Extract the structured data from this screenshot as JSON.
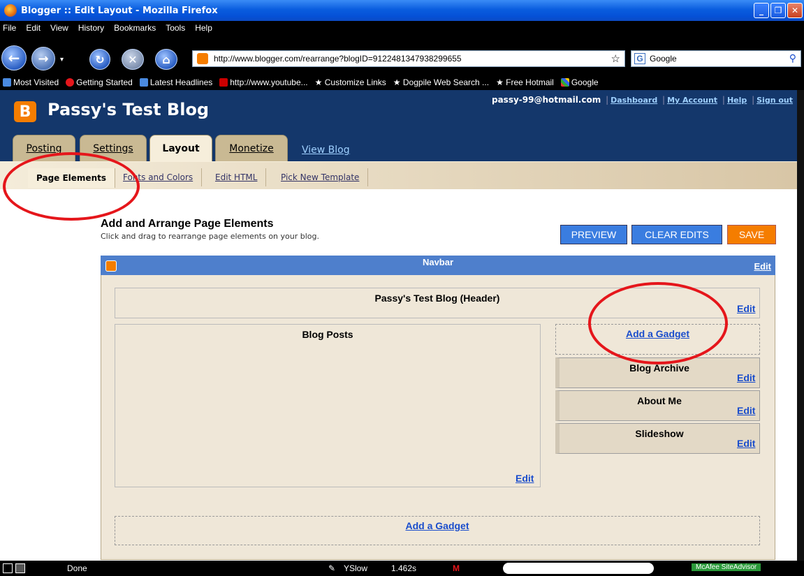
{
  "window": {
    "title": "Blogger :: Edit Layout - Mozilla Firefox"
  },
  "menu": [
    "File",
    "Edit",
    "View",
    "History",
    "Bookmarks",
    "Tools",
    "Help"
  ],
  "browser": {
    "url": "http://www.blogger.com/rearrange?blogID=9122481347938299655",
    "search": "Google"
  },
  "bookmarks": [
    "Most Visited",
    "Getting Started",
    "Latest Headlines",
    "http://www.youtube...",
    "Customize Links",
    "Dogpile Web Search ...",
    "Free Hotmail",
    "Google"
  ],
  "blog": {
    "title": "Passy's Test Blog",
    "email": "passy-99@hotmail.com",
    "links": [
      "Dashboard",
      "My Account",
      "Help",
      "Sign out"
    ]
  },
  "tabs": [
    "Posting",
    "Settings",
    "Layout",
    "Monetize"
  ],
  "view_blog": "View Blog",
  "subnav": [
    "Page Elements",
    "Fonts and Colors",
    "Edit HTML",
    "Pick New Template"
  ],
  "content": {
    "heading": "Add and Arrange Page Elements",
    "subheading": "Click and drag to rearrange page elements on your blog.",
    "preview": "PREVIEW",
    "clear": "CLEAR EDITS",
    "save": "SAVE",
    "navbar": "Navbar",
    "edit": "Edit",
    "header_widget": "Passy's Test Blog (Header)",
    "blog_posts": "Blog Posts",
    "add_gadget": "Add a Gadget",
    "sidebar": [
      "Blog Archive",
      "About Me",
      "Slideshow"
    ]
  },
  "status": {
    "text": "Done",
    "yslow": "YSlow",
    "time": "1.462s",
    "mcafee": "McAfee SiteAdvisor"
  }
}
